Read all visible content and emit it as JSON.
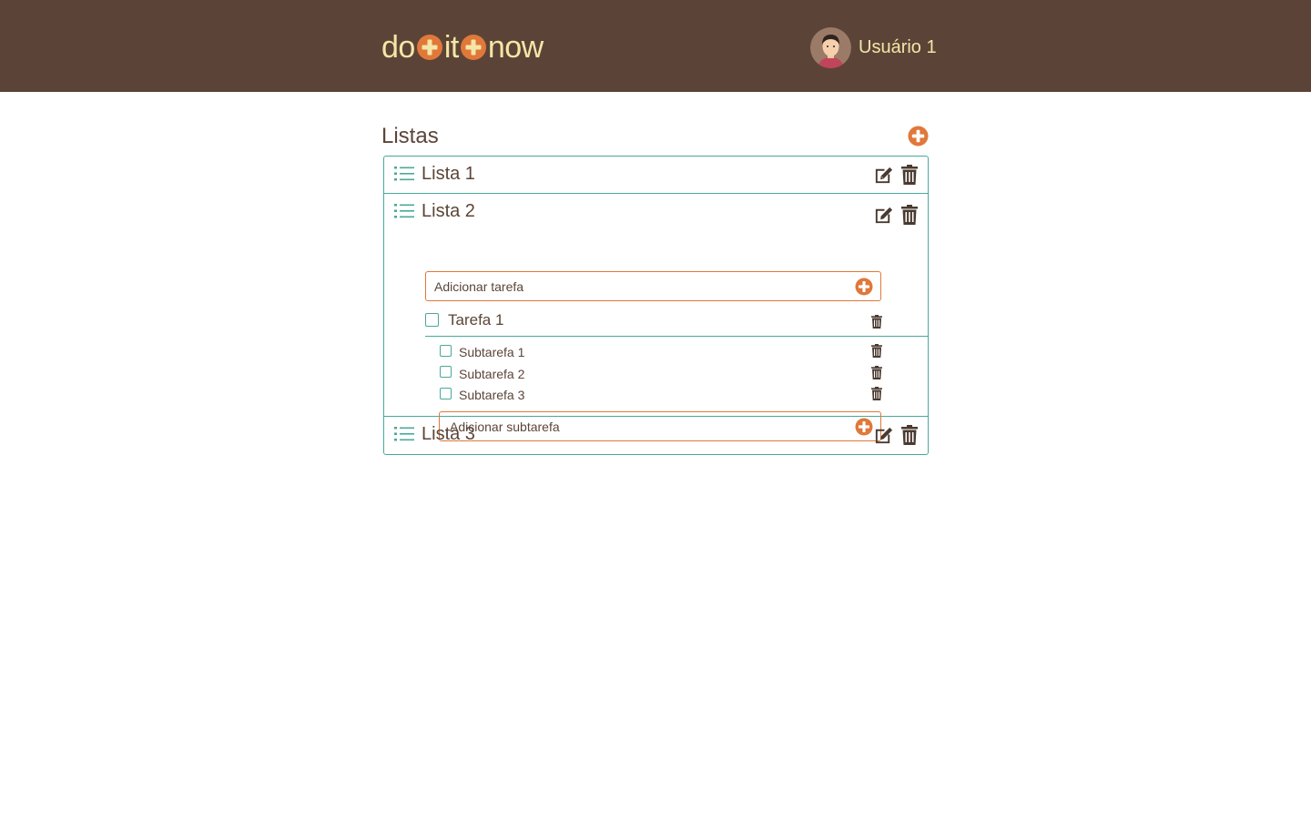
{
  "header": {
    "logo_parts": [
      "do",
      "it",
      "now"
    ],
    "user_name": "Usuário 1"
  },
  "colors": {
    "header_bg": "#5b4437",
    "logo_text": "#f4e6a6",
    "accent_orange": "#e0783a",
    "teal_border": "#48a99a",
    "text_brown": "#5b4538"
  },
  "page": {
    "title": "Listas"
  },
  "lists": [
    {
      "name": "Lista 1",
      "expanded": false
    },
    {
      "name": "Lista 2",
      "expanded": true,
      "add_task_placeholder": "Adicionar tarefa",
      "tasks": [
        {
          "name": "Tarefa 1",
          "checked": false,
          "subtasks": [
            {
              "name": "Subtarefa 1",
              "checked": false
            },
            {
              "name": "Subtarefa 2",
              "checked": false
            },
            {
              "name": "Subtarefa 3",
              "checked": false
            }
          ],
          "add_subtask_placeholder": "Adicionar subtarefa"
        }
      ]
    },
    {
      "name": "Lista 3",
      "expanded": false
    }
  ],
  "icons": {
    "list": "list-icon",
    "edit": "edit-icon",
    "delete": "trash-icon",
    "add": "plus-circle-icon",
    "avatar": "avatar"
  }
}
